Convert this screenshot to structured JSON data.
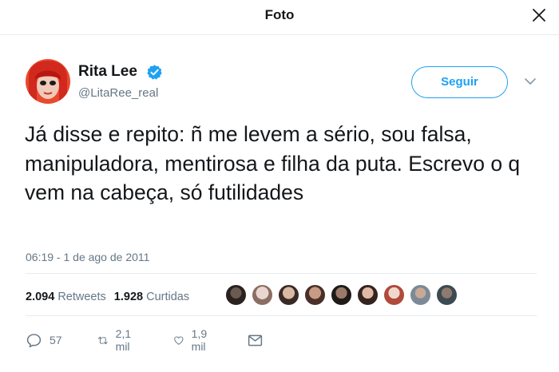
{
  "header": {
    "title": "Foto"
  },
  "user": {
    "name": "Rita Lee",
    "handle": "@LitaRee_real",
    "verified": true
  },
  "follow_label": "Seguir",
  "tweet": {
    "text": "Já disse e repito: ñ me levem a sério, sou falsa, manipuladora, mentirosa e  filha da puta. Escrevo o q vem na cabeça, só futilidades",
    "timestamp": "06:19 - 1 de ago de 2011"
  },
  "stats": {
    "retweets_count": "2.094",
    "retweets_label": "Retweets",
    "likes_count": "1.928",
    "likes_label": "Curtidas"
  },
  "actions": {
    "replies": "57",
    "retweets": "2,1 mil",
    "likes": "1,9 mil"
  },
  "colors": {
    "accent": "#1da1f2",
    "muted": "#657786",
    "text": "#14171a",
    "divider": "#e6ecf0"
  }
}
